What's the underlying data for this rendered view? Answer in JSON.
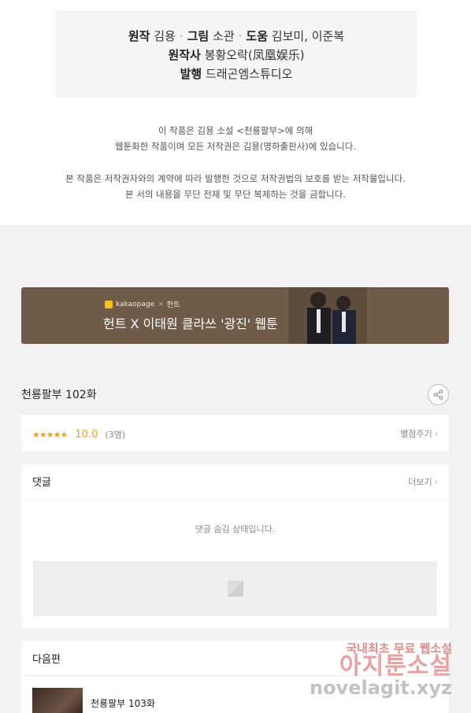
{
  "credits": {
    "original_label": "원작",
    "original_value": "김용",
    "art_label": "그림",
    "art_value": "소관",
    "assist_label": "도움",
    "assist_value": "김보미, 이준복",
    "original_company_label": "원작사",
    "original_company_value": "봉황오락(凤凰娱乐)",
    "publisher_label": "발행",
    "publisher_value": "드래곤엠스튜디오"
  },
  "notice": {
    "line1": "이 작품은 김용 소설 <천룡팔부>에 의해",
    "line2": "웹툰화한 작품이며 모든 저작권은 김용(명하출판사)에 있습니다.",
    "line3": "본 작품은 저작권자와의 계약에 따라 발행한 것으로 저작권법의 보호를 받는 저작물입니다.",
    "line4": "본 서의 내용을 무단 전재 및 무단 복제하는 것을 금합니다."
  },
  "banner": {
    "brand": "kakaopage",
    "partner": "헌트",
    "title": "헌트 X 이태원 클라쓰 '광진' 웹툰"
  },
  "episode": {
    "title": "천룡팔부 102화"
  },
  "rating": {
    "stars": "★★★★★",
    "score": "10.0",
    "count": "(3명)",
    "rate_label": "별점주기"
  },
  "comments": {
    "title": "댓글",
    "more_label": "더보기",
    "hidden_message": "댓글 숨김 상태입니다."
  },
  "next": {
    "title": "다음편",
    "item_title": "천룡팔부 103화"
  },
  "watermark": {
    "line1": "국내최초 무료 웹소설",
    "line2": "아지툰소설",
    "line3": "novelagit.xyz"
  },
  "colors": {
    "accent_star": "#f2a21c",
    "banner_bg": "#6f5b48"
  }
}
